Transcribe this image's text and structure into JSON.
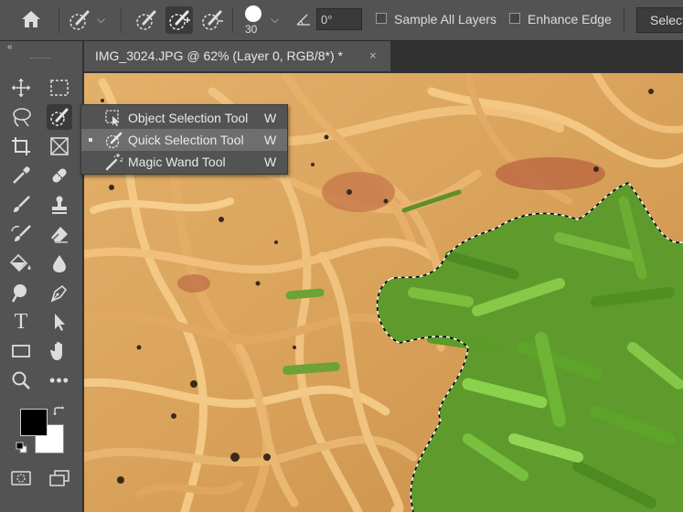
{
  "options_bar": {
    "brush_size": "30",
    "angle_value": "0°",
    "sample_all_layers_label": "Sample All Layers",
    "enhance_edge_label": "Enhance Edge",
    "select_subject_label": "Select"
  },
  "document_tab": {
    "title": "IMG_3024.JPG @ 62% (Layer 0, RGB/8*) *",
    "close_glyph": "×"
  },
  "panel_collapse_glyph": "«",
  "tool_flyout": {
    "items": [
      {
        "label": "Object Selection Tool",
        "shortcut": "W",
        "selected": false
      },
      {
        "label": "Quick Selection Tool",
        "shortcut": "W",
        "selected": true
      },
      {
        "label": "Magic Wand Tool",
        "shortcut": "W",
        "selected": false
      }
    ]
  },
  "colors": {
    "foreground": "#000000",
    "background": "#ffffff",
    "ui_panel": "#535353",
    "ui_dark": "#323232"
  },
  "toolbar_icons": [
    "move-icon",
    "marquee-icon",
    "lasso-icon",
    "quick-selection-icon",
    "crop-icon",
    "frame-icon",
    "eyedropper-icon",
    "healing-brush-icon",
    "brush-icon",
    "stamp-icon",
    "history-brush-icon",
    "eraser-icon",
    "paint-bucket-icon",
    "blur-icon",
    "dodge-icon",
    "pen-icon",
    "type-icon",
    "path-selection-icon",
    "rectangle-icon",
    "hand-icon",
    "zoom-icon",
    "more-tools-icon",
    "quick-mask-icon",
    "screen-mode-icon"
  ]
}
